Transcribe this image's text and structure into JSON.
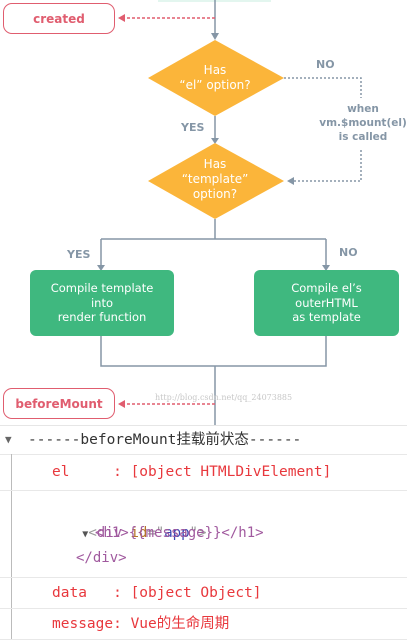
{
  "diagram": {
    "hooks": {
      "created": "created",
      "before_mount": "beforeMount"
    },
    "decision1": [
      "Has",
      "“el” option?"
    ],
    "decision2": [
      "Has",
      "“template”",
      "option?"
    ],
    "no1": "NO",
    "yes1": "YES",
    "mount_note": [
      "when",
      "vm.$mount(el)",
      "is called"
    ],
    "yes2": "YES",
    "no2": "NO",
    "box_left": [
      "Compile template",
      "into",
      "render function"
    ],
    "box_right": [
      "Compile el’s",
      "outerHTML",
      "as template"
    ],
    "watermark": "http://blog.csdn.net/qq_24073885",
    "colors": {
      "hook": "#e05d6f",
      "decision": "#fbb53a",
      "process": "#3fb87f",
      "line": "#8596a6"
    }
  },
  "console": {
    "group_title": "------beforeMount挂载前状态------",
    "el_label": "el     : ",
    "el_value": "[object HTMLDivElement]",
    "html": {
      "open_tag": "div",
      "attr_name": "id",
      "attr_value": "app",
      "inner": "<h1>{{message}}</h1>",
      "close": "</div>"
    },
    "data_label": "data   : ",
    "data_value": "[object Object]",
    "message_label": "message: ",
    "message_value": "Vue的生命周期"
  }
}
